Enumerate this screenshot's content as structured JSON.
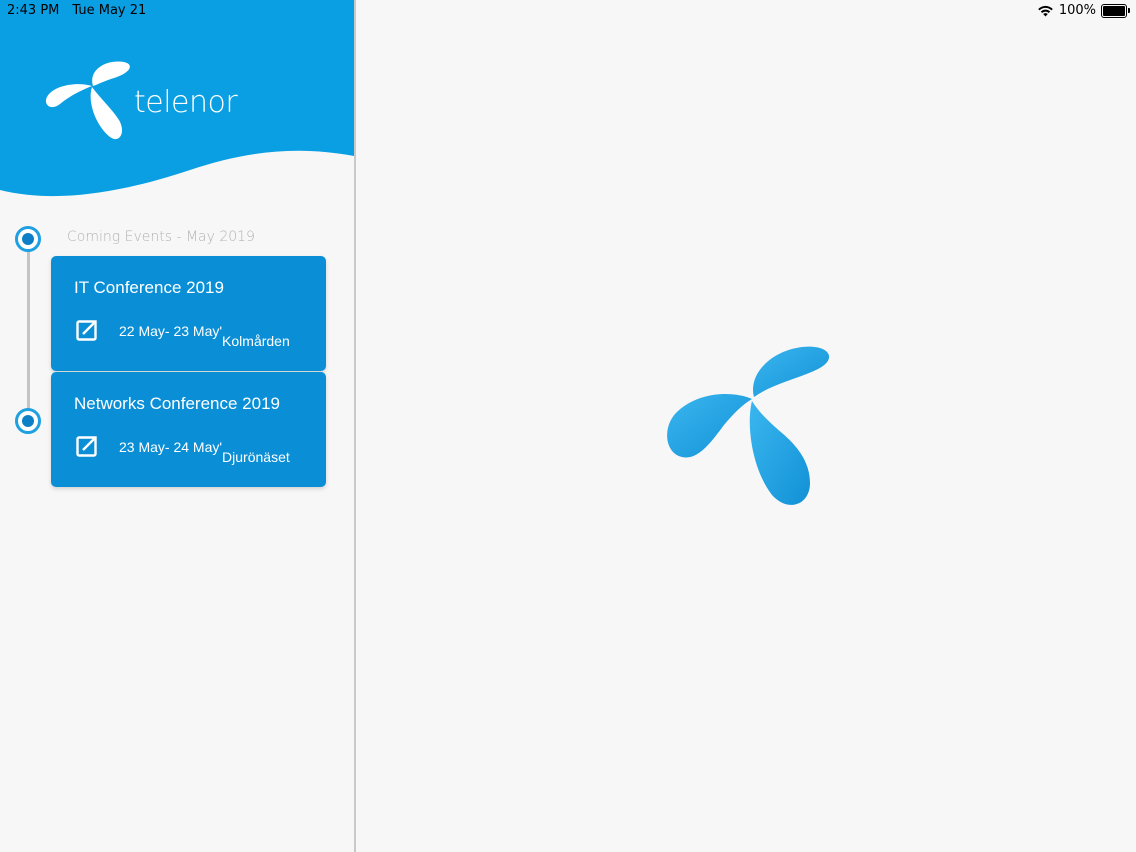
{
  "status_bar": {
    "time": "2:43 PM",
    "date": "Tue May 21",
    "battery_percent": "100%",
    "battery_level": 1.0,
    "wifi_icon": "wifi-icon",
    "battery_icon": "battery-icon"
  },
  "brand": {
    "name": "telenor",
    "accent_color": "#0a9fe3",
    "card_color": "#0a8fd6",
    "logo_icon": "telenor-propeller-icon"
  },
  "events": {
    "heading": "Coming Events - May 2019",
    "items": [
      {
        "title": "IT Conference 2019",
        "dates": "22 May- 23 May'",
        "location": "Kolmården",
        "icon": "open-external-icon"
      },
      {
        "title": "Networks Conference 2019",
        "dates": "23 May- 24 May'",
        "location": "Djurönäset",
        "icon": "open-external-icon"
      }
    ]
  }
}
